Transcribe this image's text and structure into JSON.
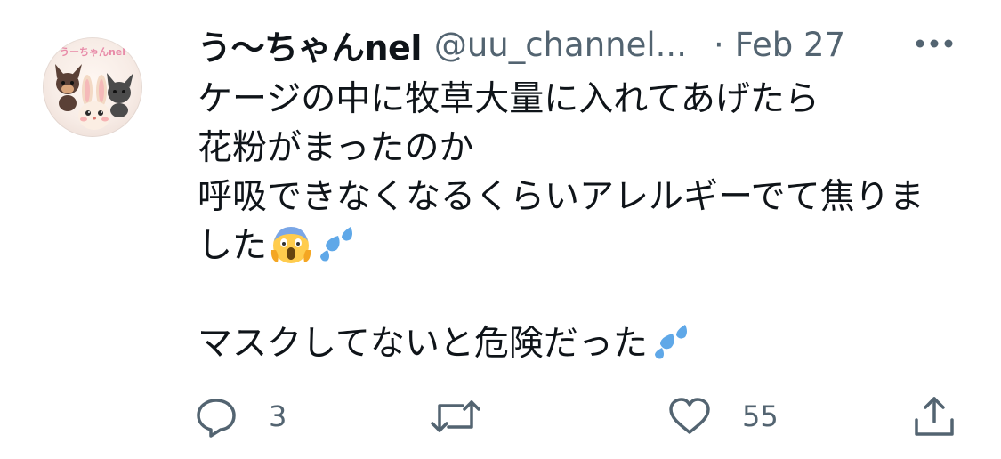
{
  "tweet": {
    "display_name": "う〜ちゃんnel",
    "handle": "@uu_channel...",
    "separator": "·",
    "date": "Feb 27",
    "avatar_text": "うーちゃんnel",
    "lines": [
      "ケージの中に牧草大量に入れてあげたら",
      "花粉がまったのか",
      "呼吸できなくなるくらいアレルギーでて焦りま",
      "した",
      "",
      "マスクしてないと危険だった"
    ]
  },
  "emojis": {
    "line4": [
      "screaming-face-emoji",
      "sweat-droplets-emoji"
    ],
    "line6": [
      "sweat-droplets-emoji"
    ]
  },
  "actions": {
    "reply_count": "3",
    "retweet_count": "",
    "like_count": "55"
  },
  "colors": {
    "text": "#0f1419",
    "secondary": "#536471",
    "emoji_blue": "#5fa8e8"
  }
}
